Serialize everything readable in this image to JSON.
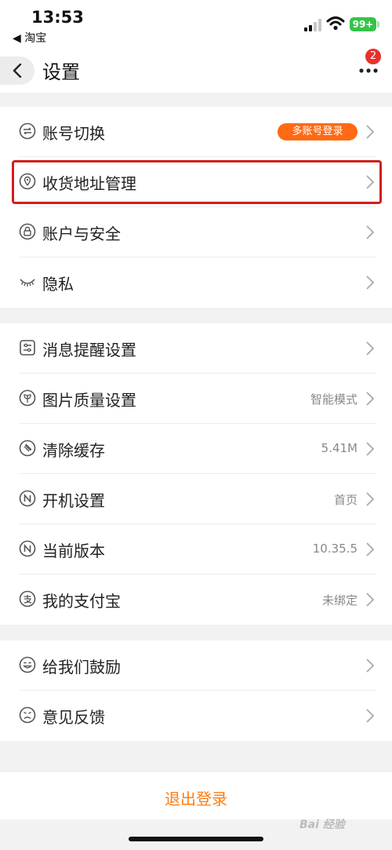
{
  "status_bar": {
    "time": "13:53",
    "back_app": "◀ 淘宝",
    "battery": "99+"
  },
  "header": {
    "title": "设置",
    "more_badge": "2"
  },
  "groups": [
    {
      "items": [
        {
          "label": "账号切换",
          "tag": "多账号登录",
          "icon": "switch-account-icon"
        },
        {
          "label": "收货地址管理",
          "icon": "location-pin-icon"
        },
        {
          "label": "账户与安全",
          "icon": "lock-icon"
        },
        {
          "label": "隐私",
          "icon": "eye-closed-icon"
        }
      ]
    },
    {
      "items": [
        {
          "label": "消息提醒设置",
          "icon": "message-settings-icon"
        },
        {
          "label": "图片质量设置",
          "value": "智能模式",
          "icon": "image-quality-icon"
        },
        {
          "label": "清除缓存",
          "value": "5.41M",
          "icon": "broom-icon"
        },
        {
          "label": "开机设置",
          "value": "首页",
          "icon": "startup-icon"
        },
        {
          "label": "当前版本",
          "value": "10.35.5",
          "icon": "version-icon"
        },
        {
          "label": "我的支付宝",
          "value": "未绑定",
          "icon": "alipay-icon"
        }
      ]
    },
    {
      "items": [
        {
          "label": "给我们鼓励",
          "icon": "smile-icon"
        },
        {
          "label": "意见反馈",
          "icon": "frown-icon"
        }
      ]
    }
  ],
  "logout_label": "退出登录",
  "watermark": "Bai 经验",
  "colors": {
    "accent": "#ff7c12",
    "tag_bg": "#ff6a13",
    "highlight": "#d21f1f",
    "badge": "#e8312c"
  }
}
